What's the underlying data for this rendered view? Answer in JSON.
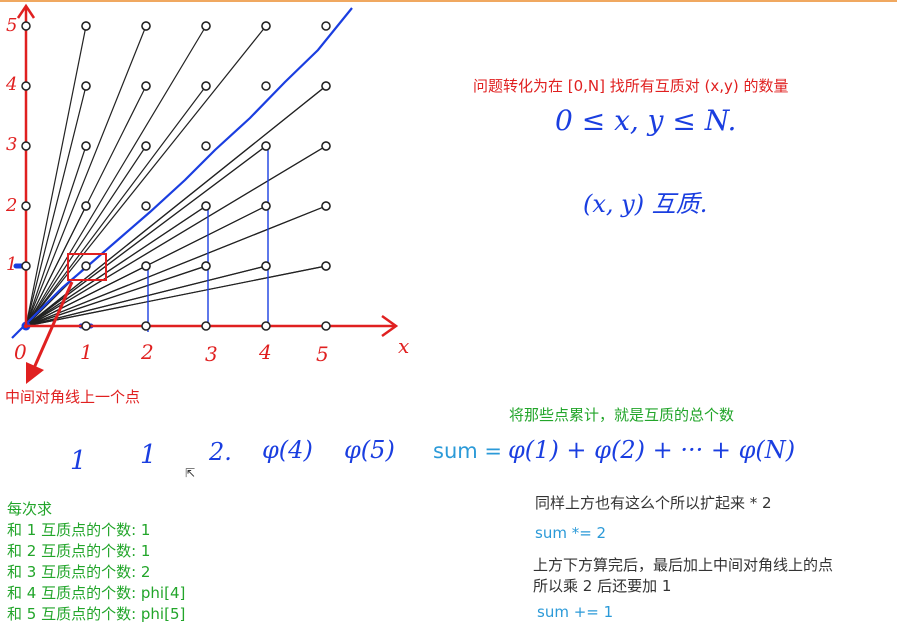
{
  "colors": {
    "axis": "#e02020",
    "rays": "#222222",
    "diagonal": "#1a3ee0",
    "pencil": "#1a3ee0",
    "caption_red": "#e02020",
    "caption_green": "#22a52a",
    "code_blue": "#2b9ad8"
  },
  "graph": {
    "x_ticks": [
      "0",
      "1",
      "2",
      "3",
      "4",
      "5"
    ],
    "y_ticks": [
      "1",
      "2",
      "3",
      "4",
      "5"
    ],
    "x_axis_label": "x",
    "grid_max": 5
  },
  "annotations": {
    "diagonal_point_note": "中间对角线上一个点",
    "problem_title": "问题转化为在 [0,N] 找所有互质对 (x,y) 的数量",
    "range_handwritten": "0 ≤ x, y ≤ N.",
    "coprime_handwritten": "(x, y) 互质.",
    "accumulate_note": "将那些点累计，就是互质的总个数",
    "counts_handwritten": [
      "1",
      "1",
      "2.",
      "φ(4)",
      "φ(5)"
    ],
    "sum_label": "sum =",
    "sum_formula_handwritten": "φ(1) + φ(2) + ··· + φ(N)"
  },
  "left_list": {
    "heading": "每次求",
    "items": [
      "和 1 互质点的个数: 1",
      "和 2 互质点的个数: 1",
      "和 3 互质点的个数: 2",
      "和 4 互质点的个数: phi[4]",
      "和 5 互质点的个数: phi[5]"
    ]
  },
  "right_notes": {
    "line1": "同样上方也有这么个所以扩起来 * 2",
    "code1": "sum *= 2",
    "line2": "上方下方算完后，最后加上中间对角线上的点",
    "line3": "所以乘 2 后还要加 1",
    "code2": "sum += 1"
  }
}
